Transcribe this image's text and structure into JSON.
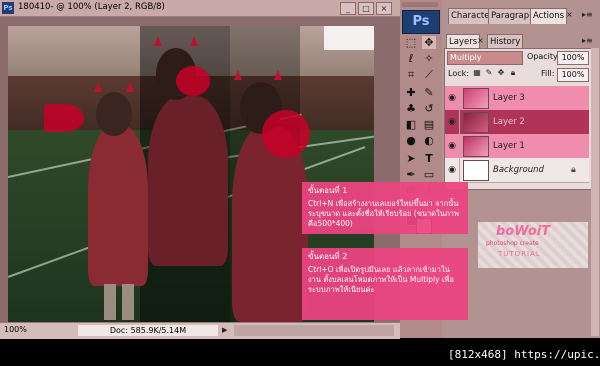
{
  "document": {
    "title": "180410- @ 100% (Layer 2, RGB/8)",
    "zoom": "100%",
    "doc_size": "Doc: 585.9K/5.14M"
  },
  "window_buttons": [
    "_",
    "□",
    "×"
  ],
  "tools": {
    "logo": "Ps"
  },
  "top_tabs": [
    "Characte",
    "Paragrapl",
    "Actions",
    "×"
  ],
  "layers_tabs": [
    "Layers",
    "×",
    "History"
  ],
  "layers_panel": {
    "blend_mode": "Multiply",
    "opacity_label": "Opacity:",
    "opacity_value": "100%",
    "lock_label": "Lock:",
    "fill_label": "Fill:",
    "fill_value": "100%",
    "layers": [
      {
        "name": "Layer 3",
        "selected": false
      },
      {
        "name": "Layer 2",
        "selected": true
      },
      {
        "name": "Layer 1",
        "selected": false
      },
      {
        "name": "Background",
        "selected": false
      }
    ]
  },
  "notes": [
    {
      "title": "ขั้นตอนที่ 1",
      "body": "Ctrl+N เพื่อสร้างงานเลเยอร์ใหม่ขึ้นมา จากนั้นระบุขนาด และตั้งชื่อให้เรียบร้อย (ขนาดในภาพคือ500*400)"
    },
    {
      "title": "ขั้นตอนที่ 2",
      "body": "Ctrl+O เพื่อเปิดรูปมีนเลย แล้วลากเข้ามาในงาน ตั้งบลเลนโหมดภาพให้เป็น Multiply เพื่อระบบภาพให้เนียนค่ะ"
    }
  ],
  "watermark": {
    "line1": "boWoiT",
    "line2": "photoshop create",
    "line3": "TUTORIAL"
  },
  "upic_label": "[812x468] https://upic.me/",
  "colors": {
    "accent": "#ec4480",
    "selected_layer": "#b0345a",
    "layer_row": "#f08cad"
  }
}
